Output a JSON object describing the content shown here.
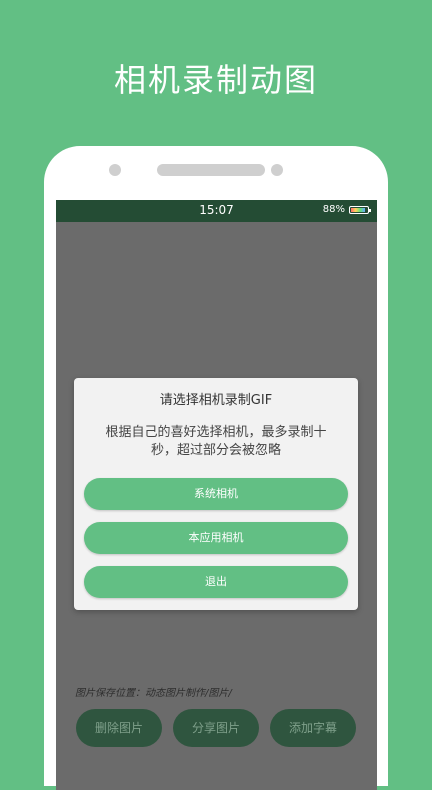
{
  "promo": {
    "title": "相机录制动图"
  },
  "status_bar": {
    "time": "15:07",
    "battery_percent": "88%",
    "battery_level": 0.88
  },
  "dialog": {
    "title": "请选择相机录制GIF",
    "message": "根据自己的喜好选择相机，最多录制十秒，超过部分会被忽略",
    "buttons": {
      "system_camera": "系统相机",
      "app_camera": "本应用相机",
      "exit": "退出"
    }
  },
  "screen": {
    "save_path": "图片保存位置：动态图片制作/图片/",
    "actions": {
      "delete": "删除图片",
      "share": "分享图片",
      "add_subtitle": "添加字幕"
    }
  },
  "colors": {
    "brand_green": "#62bf84",
    "status_bar": "#244c34",
    "dimmed_button": "#2f553f"
  }
}
